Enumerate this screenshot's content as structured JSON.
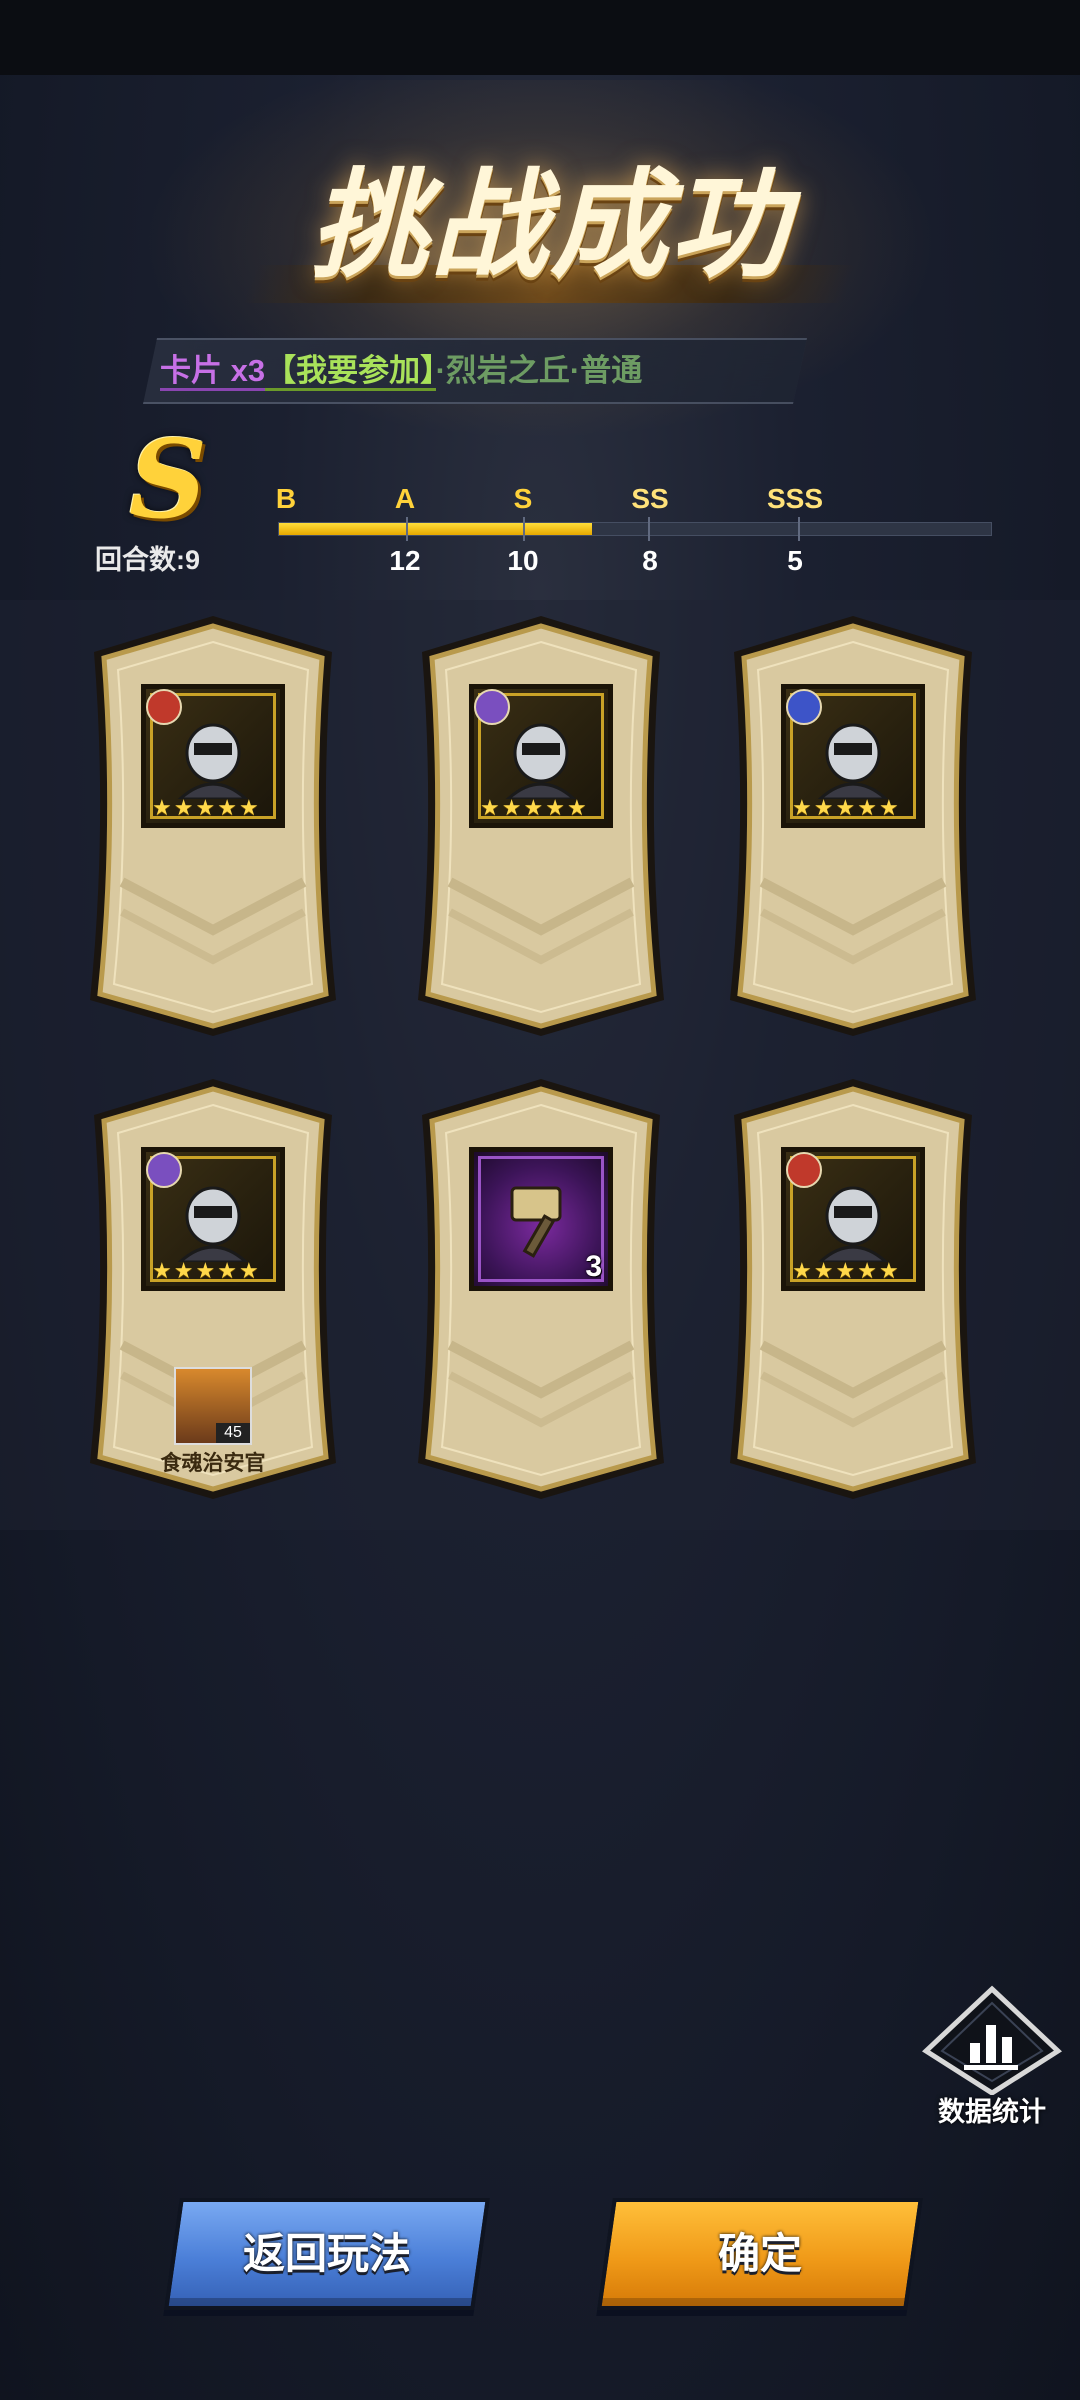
{
  "header": {
    "title": "挑战成功"
  },
  "ticker": {
    "part_a": "卡片 x3",
    "part_b": "【我要参加】",
    "part_c": "·烈岩之丘·普通"
  },
  "grade": {
    "current": "S",
    "rounds_label": "回合数:9",
    "progress": 0.44,
    "tiers": [
      {
        "label": "B",
        "rounds": ""
      },
      {
        "label": "A",
        "rounds": "12"
      },
      {
        "label": "S",
        "rounds": "10"
      },
      {
        "label": "SS",
        "rounds": "8"
      },
      {
        "label": "SSS",
        "rounds": "5"
      }
    ]
  },
  "rewards": [
    {
      "kind": "hero",
      "badge": "sword-badge-icon",
      "badge_color": "#c0392b",
      "stars": 5,
      "art": "dark-armored-hero-icon"
    },
    {
      "kind": "hero",
      "badge": "magic-badge-icon",
      "badge_color": "#7a4fbf",
      "stars": 5,
      "art": "red-masked-hero-icon"
    },
    {
      "kind": "hero",
      "badge": "swirl-badge-icon",
      "badge_color": "#3d54c8",
      "stars": 5,
      "art": "white-robed-hero-icon"
    },
    {
      "kind": "hero",
      "badge": "magic-badge-icon",
      "badge_color": "#7a4fbf",
      "stars": 5,
      "art": "skull-knight-hero-icon",
      "drop": {
        "level": "45",
        "name": "食魂治安官"
      }
    },
    {
      "kind": "item",
      "art": "hammer-item-icon",
      "quantity": "3"
    },
    {
      "kind": "hero",
      "badge": "sword-badge-icon",
      "badge_color": "#c0392b",
      "stars": 5,
      "art": "teal-skull-hero-icon"
    }
  ],
  "stats": {
    "label": "数据统计",
    "icon": "bar-chart-icon"
  },
  "buttons": {
    "back_label": "返回玩法",
    "confirm_label": "确定"
  },
  "colors": {
    "accent_gold": "#ffd23a",
    "back_blue": "#4b7fd8",
    "confirm_orange": "#f09a18",
    "card_parchment": "#d9c9a0"
  }
}
